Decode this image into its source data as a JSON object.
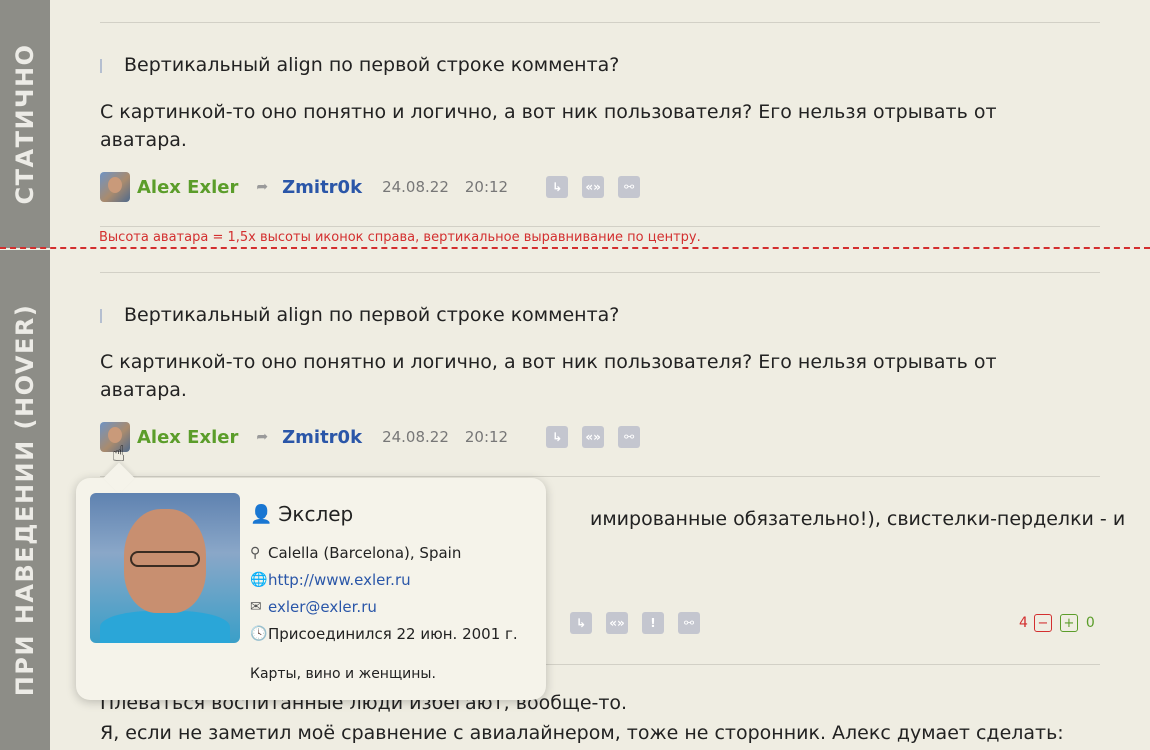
{
  "sidebar": {
    "static_label": "СТАТИЧНО",
    "hover_label": "ПРИ НАВЕДЕНИИ (HOVER)"
  },
  "annotation": "Высота аватара = 1,5х высоты иконок справа, вертикальное выравнивание по центру.",
  "comment_static": {
    "quote": "Вертикальный align по первой строке коммента?",
    "body": "С картинкой-то оно понятно и логично, а вот ник пользователя? Его нельзя отрывать от аватара.",
    "author": "Alex Exler",
    "reply_to": "Zmitr0k",
    "date": "24.08.22",
    "time": "20:12"
  },
  "comment_hover": {
    "quote": "Вертикальный align по первой строке коммента?",
    "body": "С картинкой-то оно понятно и логично, а вот ник пользователя? Его нельзя отрывать от аватара.",
    "author": "Alex Exler",
    "reply_to": "Zmitr0k",
    "date": "24.08.22",
    "time": "20:12"
  },
  "comment_third": {
    "body_visible": "имированные обязательно!), свистелки-перделки - и",
    "votes_minus": "4",
    "votes_plus": "0"
  },
  "comment_fourth": {
    "line1": "Плеваться воспитанные люди избегают, вообще-то.",
    "line2": "Я, если не заметил моё сравнение с авиалайнером, тоже не сторонник. Алекс думает сделать:"
  },
  "popup": {
    "name": "Экслер",
    "location": "Calella (Barcelona), Spain",
    "website": "http://www.exler.ru",
    "email": "exler@exler.ru",
    "joined": "Присоединился 22 июн. 2001 г.",
    "motto": "Карты, вино и женщины."
  },
  "icons": {
    "reply": "reply-icon",
    "quote": "quote-icon",
    "link": "link-icon",
    "report": "report-icon",
    "user": "user-icon",
    "location": "map-pin-icon",
    "globe": "globe-icon",
    "mail": "envelope-icon",
    "clock": "clock-icon"
  },
  "colors": {
    "author": "#5b9d2a",
    "reply_to": "#2a56a8",
    "annotation": "#d32f2f",
    "sidebar": "#8d8d87",
    "background": "#efede2"
  }
}
